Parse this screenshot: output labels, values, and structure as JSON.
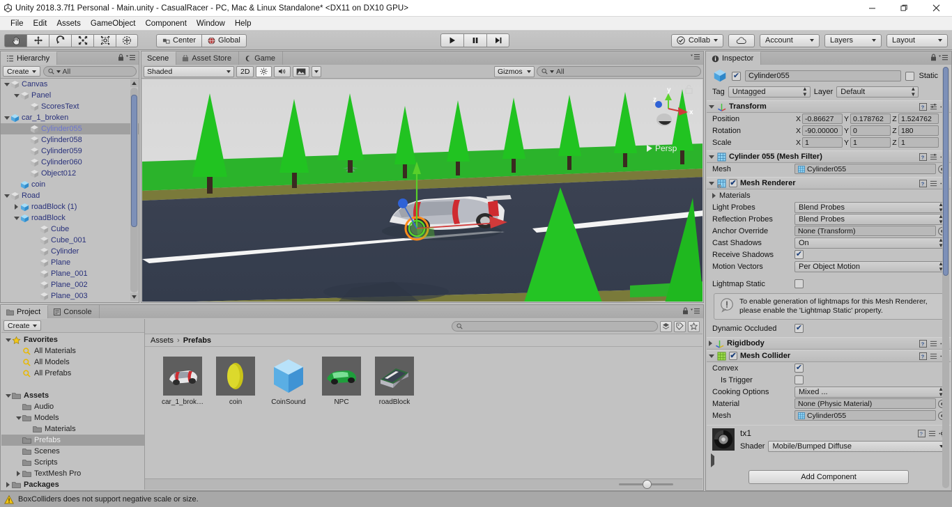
{
  "window": {
    "title": "Unity 2018.3.7f1 Personal - Main.unity - CasualRacer - PC, Mac & Linux Standalone* <DX11 on DX10 GPU>",
    "app_icon": "unity-icon",
    "minimize": "—",
    "maximize": "❐",
    "close": "✕"
  },
  "menu": {
    "items": [
      "File",
      "Edit",
      "Assets",
      "GameObject",
      "Component",
      "Window",
      "Help"
    ]
  },
  "toolbar": {
    "tools": [
      {
        "name": "hand-tool",
        "active": true
      },
      {
        "name": "move-tool",
        "active": false
      },
      {
        "name": "rotate-tool",
        "active": false
      },
      {
        "name": "scale-tool",
        "active": false
      },
      {
        "name": "rect-tool",
        "active": false
      },
      {
        "name": "transform-tool",
        "active": false
      }
    ],
    "pivot_label": "Center",
    "space_label": "Global",
    "play": "▶",
    "pause": "❚❚",
    "step": "▶❙",
    "collab_label": "Collab",
    "cloud_label": "cloud-icon",
    "account_label": "Account",
    "layers_label": "Layers",
    "layout_label": "Layout"
  },
  "hierarchy": {
    "tab": "Hierarchy",
    "create_label": "Create",
    "search_placeholder": "All",
    "items": [
      {
        "label": "Canvas",
        "depth": 1,
        "toggle": "down",
        "icon": "gameobject",
        "selected": false,
        "prefab": false,
        "chevron": false
      },
      {
        "label": "Panel",
        "depth": 2,
        "toggle": "down",
        "icon": "gameobject",
        "selected": false,
        "prefab": false,
        "chevron": false
      },
      {
        "label": "ScoresText",
        "depth": 3,
        "toggle": "none",
        "icon": "gameobject",
        "selected": false,
        "prefab": false,
        "chevron": false
      },
      {
        "label": "car_1_broken",
        "depth": 1,
        "toggle": "down",
        "icon": "prefab",
        "selected": false,
        "prefab": true,
        "chevron": true
      },
      {
        "label": "Cylinder055",
        "depth": 3,
        "toggle": "none",
        "icon": "gameobject",
        "selected": true,
        "prefab": false,
        "chevron": false
      },
      {
        "label": "Cylinder058",
        "depth": 3,
        "toggle": "none",
        "icon": "gameobject",
        "selected": false,
        "prefab": false,
        "chevron": false
      },
      {
        "label": "Cylinder059",
        "depth": 3,
        "toggle": "none",
        "icon": "gameobject",
        "selected": false,
        "prefab": false,
        "chevron": false
      },
      {
        "label": "Cylinder060",
        "depth": 3,
        "toggle": "none",
        "icon": "gameobject",
        "selected": false,
        "prefab": false,
        "chevron": false
      },
      {
        "label": "Object012",
        "depth": 3,
        "toggle": "none",
        "icon": "gameobject",
        "selected": false,
        "prefab": false,
        "chevron": false
      },
      {
        "label": "coin",
        "depth": 2,
        "toggle": "none",
        "icon": "prefab",
        "selected": false,
        "prefab": true,
        "chevron": true
      },
      {
        "label": "Road",
        "depth": 1,
        "toggle": "down",
        "icon": "gameobject",
        "selected": false,
        "prefab": false,
        "chevron": false
      },
      {
        "label": "roadBlock (1)",
        "depth": 2,
        "toggle": "right",
        "icon": "prefab",
        "selected": false,
        "prefab": true,
        "chevron": true
      },
      {
        "label": "roadBlock",
        "depth": 2,
        "toggle": "down",
        "icon": "prefab",
        "selected": false,
        "prefab": true,
        "chevron": true
      },
      {
        "label": "Cube",
        "depth": 4,
        "toggle": "none",
        "icon": "gameobject",
        "selected": false,
        "prefab": false,
        "chevron": false
      },
      {
        "label": "Cube_001",
        "depth": 4,
        "toggle": "none",
        "icon": "gameobject",
        "selected": false,
        "prefab": false,
        "chevron": false
      },
      {
        "label": "Cylinder",
        "depth": 4,
        "toggle": "none",
        "icon": "gameobject",
        "selected": false,
        "prefab": false,
        "chevron": false
      },
      {
        "label": "Plane",
        "depth": 4,
        "toggle": "none",
        "icon": "gameobject",
        "selected": false,
        "prefab": false,
        "chevron": false
      },
      {
        "label": "Plane_001",
        "depth": 4,
        "toggle": "none",
        "icon": "gameobject",
        "selected": false,
        "prefab": false,
        "chevron": false
      },
      {
        "label": "Plane_002",
        "depth": 4,
        "toggle": "none",
        "icon": "gameobject",
        "selected": false,
        "prefab": false,
        "chevron": false
      },
      {
        "label": "Plane_003",
        "depth": 4,
        "toggle": "none",
        "icon": "gameobject",
        "selected": false,
        "prefab": false,
        "chevron": false
      }
    ]
  },
  "scene": {
    "tabs": [
      {
        "label": "Scene",
        "icon": "scene-icon",
        "active": true
      },
      {
        "label": "Asset Store",
        "icon": "store-icon",
        "active": false
      },
      {
        "label": "Game",
        "icon": "game-icon",
        "active": false
      }
    ],
    "draw_mode": "Shaded",
    "mode_2d": "2D",
    "lighting_icon": "sun-icon",
    "audio_icon": "speaker-icon",
    "fx_icon": "image-icon",
    "gizmos_label": "Gizmos",
    "search_placeholder": "All",
    "gizmo_axes": {
      "x": "x",
      "y": "y",
      "z": "z"
    },
    "projection_label": "Persp"
  },
  "inspector": {
    "tab": "Inspector",
    "object_name": "Cylinder055",
    "object_enabled": true,
    "static_label": "Static",
    "static_checked": false,
    "tag_label": "Tag",
    "tag_value": "Untagged",
    "layer_label": "Layer",
    "layer_value": "Default",
    "components": [
      {
        "title": "Transform",
        "icon": "transform-icon",
        "expanded": true,
        "enabled": null,
        "vectors": [
          {
            "label": "Position",
            "x": "-0.86627",
            "y": "0.178762",
            "z": "1.524762"
          },
          {
            "label": "Rotation",
            "x": "-90.00000",
            "y": "0",
            "z": "180"
          },
          {
            "label": "Scale",
            "x": "1",
            "y": "1",
            "z": "1"
          }
        ]
      },
      {
        "title": "Cylinder 055 (Mesh Filter)",
        "icon": "meshfilter-icon",
        "expanded": true,
        "rows": [
          {
            "label": "Mesh",
            "type": "object",
            "value": "Cylinder055"
          }
        ]
      },
      {
        "title": "Mesh Renderer",
        "icon": "meshrenderer-icon",
        "expanded": true,
        "enabled": true,
        "rows": [
          {
            "label": "Materials",
            "type": "foldout"
          },
          {
            "label": "Light Probes",
            "type": "dropdown",
            "value": "Blend Probes"
          },
          {
            "label": "Reflection Probes",
            "type": "dropdown",
            "value": "Blend Probes"
          },
          {
            "label": "Anchor Override",
            "type": "object",
            "value": "None (Transform)"
          },
          {
            "label": "Cast Shadows",
            "type": "dropdown",
            "value": "On"
          },
          {
            "label": "Receive Shadows",
            "type": "checkbox",
            "value": true
          },
          {
            "label": "Motion Vectors",
            "type": "dropdown",
            "value": "Per Object Motion"
          },
          {
            "label": "Lightmap Static",
            "type": "checkbox",
            "value": false
          }
        ],
        "helpbox": "To enable generation of lightmaps for this Mesh Renderer, please enable the 'Lightmap Static' property.",
        "rows2": [
          {
            "label": "Dynamic Occluded",
            "type": "checkbox",
            "value": true
          }
        ]
      },
      {
        "title": "Rigidbody",
        "icon": "rigidbody-icon",
        "expanded": false,
        "enabled": null
      },
      {
        "title": "Mesh Collider",
        "icon": "meshcollider-icon",
        "expanded": true,
        "enabled": true,
        "rows": [
          {
            "label": "Convex",
            "type": "checkbox",
            "value": true
          },
          {
            "label": "Is Trigger",
            "type": "checkbox",
            "value": false,
            "indent": true
          },
          {
            "label": "Cooking Options",
            "type": "dropdown",
            "value": "Mixed ..."
          },
          {
            "label": "Material",
            "type": "object",
            "value": "None (Physic Material)"
          },
          {
            "label": "Mesh",
            "type": "object",
            "value": "Cylinder055"
          }
        ]
      }
    ],
    "material": {
      "name": "tx1",
      "shader_label": "Shader",
      "shader_value": "Mobile/Bumped Diffuse"
    },
    "add_component_label": "Add Component"
  },
  "project": {
    "tabs": [
      {
        "label": "Project",
        "icon": "folder-icon",
        "active": true
      },
      {
        "label": "Console",
        "icon": "console-icon",
        "active": false
      }
    ],
    "create_label": "Create",
    "search_placeholder": "",
    "tree": [
      {
        "label": "Favorites",
        "depth": 0,
        "toggle": "down",
        "icon": "star",
        "bold": true,
        "selected": false
      },
      {
        "label": "All Materials",
        "depth": 1,
        "toggle": "none",
        "icon": "search",
        "bold": false,
        "selected": false
      },
      {
        "label": "All Models",
        "depth": 1,
        "toggle": "none",
        "icon": "search",
        "bold": false,
        "selected": false
      },
      {
        "label": "All Prefabs",
        "depth": 1,
        "toggle": "none",
        "icon": "search",
        "bold": false,
        "selected": false
      },
      {
        "label": "",
        "depth": 0,
        "toggle": "none",
        "icon": "none",
        "bold": false,
        "selected": false
      },
      {
        "label": "Assets",
        "depth": 0,
        "toggle": "down",
        "icon": "folder",
        "bold": true,
        "selected": false
      },
      {
        "label": "Audio",
        "depth": 1,
        "toggle": "none",
        "icon": "folder",
        "bold": false,
        "selected": false
      },
      {
        "label": "Models",
        "depth": 1,
        "toggle": "down",
        "icon": "folder",
        "bold": false,
        "selected": false
      },
      {
        "label": "Materials",
        "depth": 2,
        "toggle": "none",
        "icon": "folder",
        "bold": false,
        "selected": false
      },
      {
        "label": "Prefabs",
        "depth": 1,
        "toggle": "none",
        "icon": "folder",
        "bold": false,
        "selected": true
      },
      {
        "label": "Scenes",
        "depth": 1,
        "toggle": "none",
        "icon": "folder",
        "bold": false,
        "selected": false
      },
      {
        "label": "Scripts",
        "depth": 1,
        "toggle": "none",
        "icon": "folder",
        "bold": false,
        "selected": false
      },
      {
        "label": "TextMesh Pro",
        "depth": 1,
        "toggle": "right",
        "icon": "folder",
        "bold": false,
        "selected": false
      },
      {
        "label": "Packages",
        "depth": 0,
        "toggle": "right",
        "icon": "folder",
        "bold": true,
        "selected": false
      }
    ],
    "breadcrumb": [
      "Assets",
      "Prefabs"
    ],
    "assets": [
      {
        "label": "car_1_brok…",
        "kind": "car-white"
      },
      {
        "label": "coin",
        "kind": "coin"
      },
      {
        "label": "CoinSound",
        "kind": "cube"
      },
      {
        "label": "NPC",
        "kind": "car-green"
      },
      {
        "label": "roadBlock",
        "kind": "road"
      }
    ]
  },
  "status": {
    "icon": "warning-icon",
    "message": "BoxColliders does not support negative scale or size."
  },
  "colors": {
    "chrome": "#c2c2c2",
    "panel_header": "#b4b4b4",
    "selection": "#a0a0a0",
    "tree_text": "#28307a",
    "accent_blue": "#7d90b8",
    "warning": "#f1c40f"
  }
}
